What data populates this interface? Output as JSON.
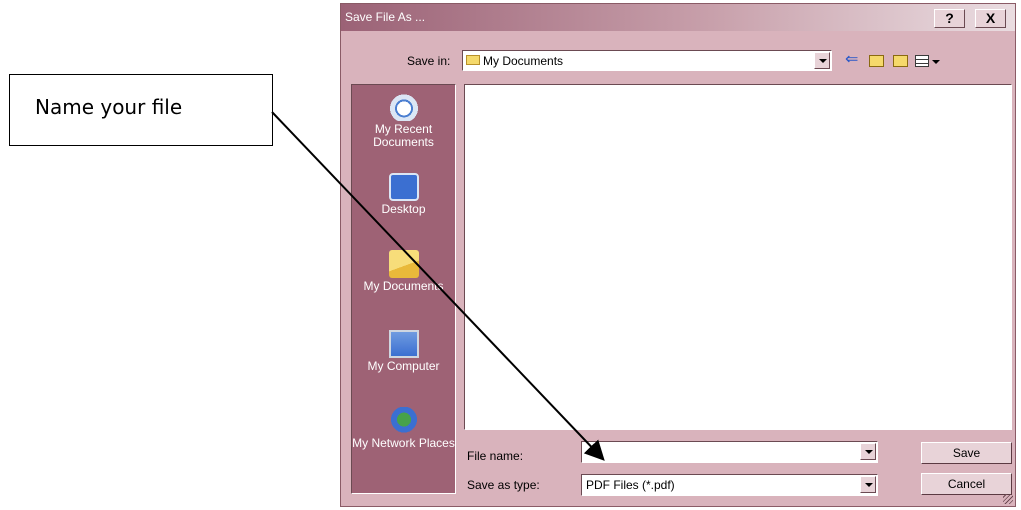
{
  "callout": {
    "text": "Name your file"
  },
  "dialog": {
    "title": "Save File As ...",
    "help_label": "?",
    "close_label": "X",
    "save_in_label": "Save in:",
    "save_in_value": "My Documents",
    "places": [
      {
        "label": "My Recent Documents",
        "icon": "recent-documents-icon"
      },
      {
        "label": "Desktop",
        "icon": "desktop-icon"
      },
      {
        "label": "My Documents",
        "icon": "my-documents-icon"
      },
      {
        "label": "My Computer",
        "icon": "my-computer-icon"
      },
      {
        "label": "My Network Places",
        "icon": "network-places-icon"
      }
    ],
    "file_name_label": "File name:",
    "file_name_value": "",
    "save_as_type_label": "Save as type:",
    "save_as_type_value": "PDF Files (*.pdf)",
    "save_button": "Save",
    "cancel_button": "Cancel",
    "colors": {
      "title_start": "#9b6276",
      "face": "#d9b3bc",
      "places_bg": "#9e6275"
    }
  }
}
